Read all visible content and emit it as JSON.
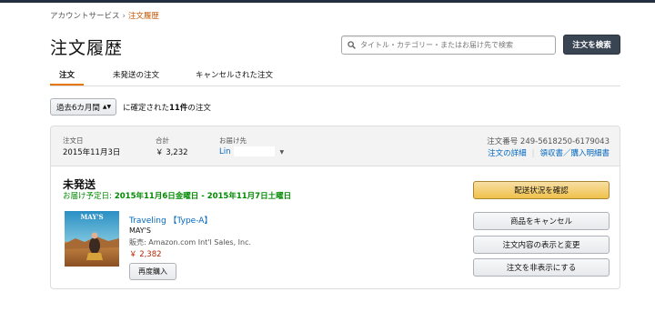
{
  "breadcrumb": {
    "parent": "アカウントサービス",
    "separator": "›",
    "current": "注文履歴"
  },
  "page_title": "注文履歴",
  "search": {
    "placeholder": "タイトル・カテゴリー・またはお届け先で検索",
    "button_label": "注文を検索"
  },
  "tabs": [
    {
      "label": "注文",
      "active": true
    },
    {
      "label": "未発送の注文",
      "active": false
    },
    {
      "label": "キャンセルされた注文",
      "active": false
    }
  ],
  "filter": {
    "selected": "過去6カ月間",
    "summary_prefix": "に確定された",
    "count": "11件",
    "summary_suffix": "の注文"
  },
  "order": {
    "date_label": "注文日",
    "date_value": "2015年11月3日",
    "total_label": "合計",
    "total_value": "￥ 3,232",
    "ship_label": "お届け先",
    "ship_value": "Lin",
    "order_number": "注文番号 249-5618250-6179043",
    "details_link": "注文の詳細",
    "receipt_link": "領収書／購入明細書",
    "status": "未発送",
    "delivery_label": "お届け予定日:",
    "delivery_value": "2015年11月6日金曜日 - 2015年11月7日土曜日",
    "item": {
      "title": "Traveling 【Type-A】",
      "artist": "MAY'S",
      "seller": "販売: Amazon.com Int'l Sales, Inc.",
      "price": "￥ 2,382",
      "rebuy_label": "再度購入",
      "cover_text": "MAY'S"
    },
    "actions": {
      "track": "配送状況を確認",
      "cancel": "商品をキャンセル",
      "edit": "注文内容の表示と変更",
      "hide": "注文を非表示にする"
    }
  },
  "colors": {
    "accent": "#e77600",
    "link": "#0066c0",
    "delivery": "#008a00",
    "price": "#b12704",
    "primary_button": "#f0c14b"
  }
}
